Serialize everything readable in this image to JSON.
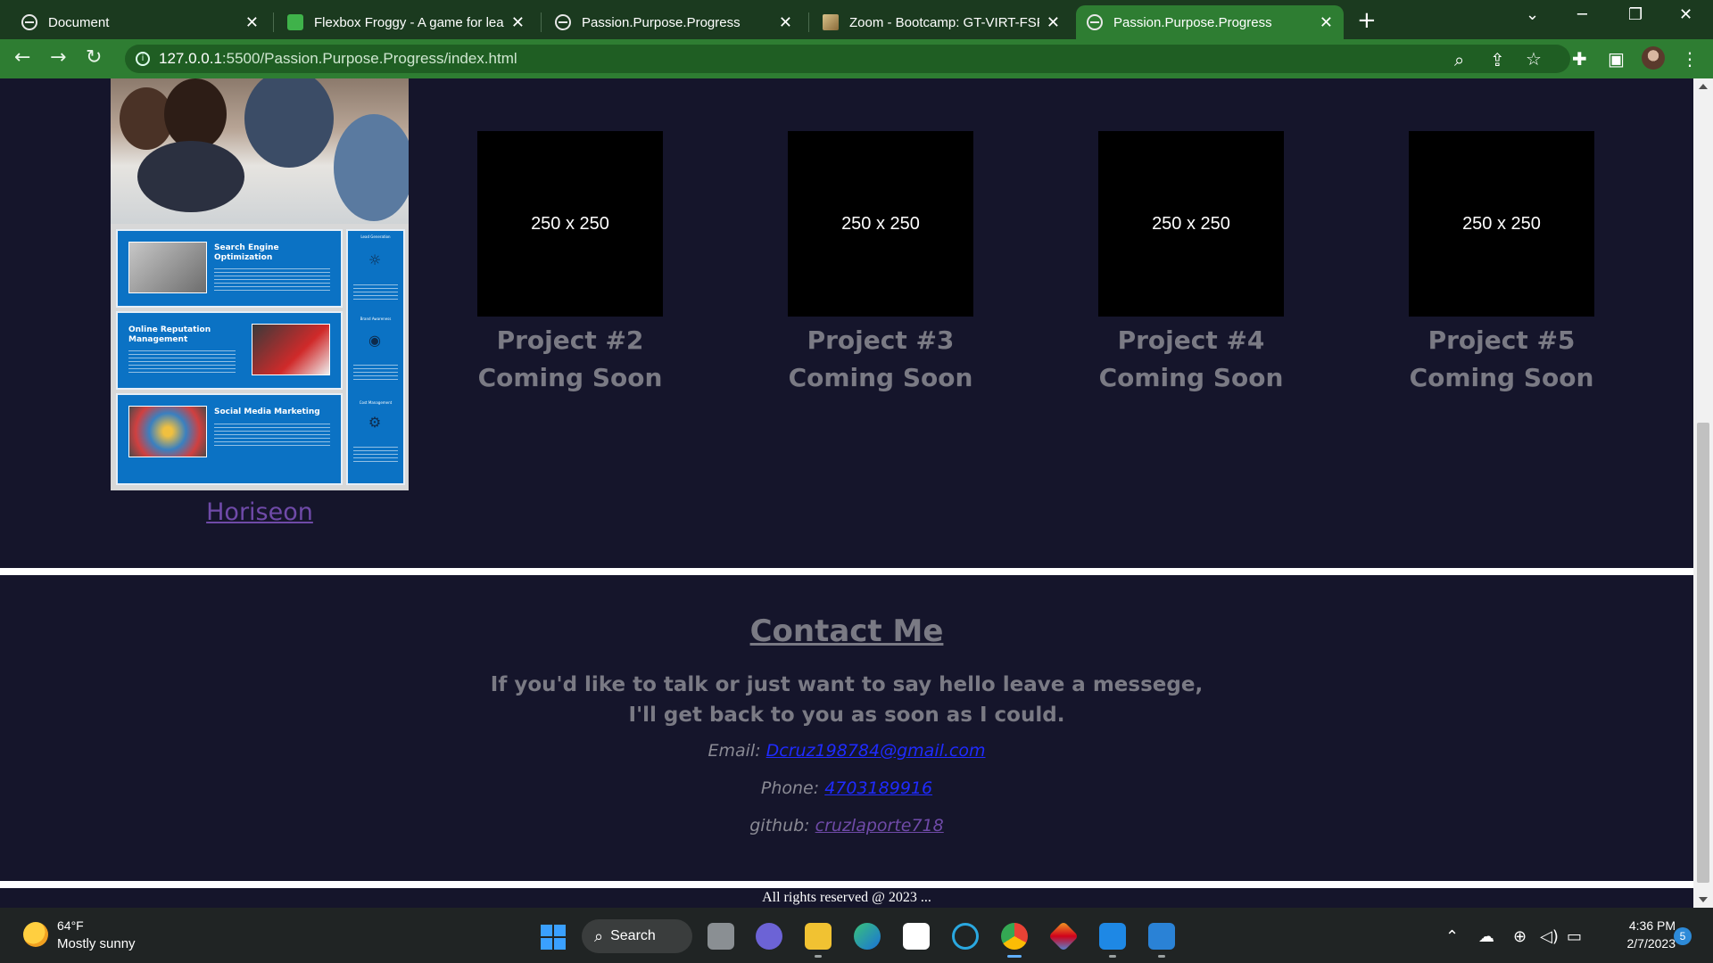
{
  "browser": {
    "tabs": [
      {
        "title": "Document",
        "close": "✕"
      },
      {
        "title": "Flexbox Froggy - A game for learning CSS flexbox",
        "close": "✕"
      },
      {
        "title": "Passion.Purpose.Progress",
        "close": "✕"
      },
      {
        "title": "Zoom - Bootcamp: GT-VIRT-FSF-",
        "close": "✕"
      },
      {
        "title": "Passion.Purpose.Progress",
        "close": "✕",
        "active": true
      }
    ],
    "new_tab": "+",
    "url_host": "127.0.0.1",
    "url_rest": ":5500/Passion.Purpose.Progress/index.html",
    "accent": "#2e7d32"
  },
  "portfolio": {
    "featured": {
      "title": "Horiseon"
    },
    "panel": {
      "sections": [
        {
          "heading": "Search Engine Optimization"
        },
        {
          "heading": "Online Reputation Management"
        },
        {
          "heading": "Social Media Marketing"
        }
      ],
      "side": [
        "Lead Generation",
        "Brand Awareness",
        "Cost Management"
      ]
    },
    "placeholders": [
      {
        "size": "250 x 250",
        "title": "Project #2",
        "status": "Coming Soon"
      },
      {
        "size": "250 x 250",
        "title": "Project #3",
        "status": "Coming Soon"
      },
      {
        "size": "250 x 250",
        "title": "Project #4",
        "status": "Coming Soon"
      },
      {
        "size": "250 x 250",
        "title": "Project #5",
        "status": "Coming Soon"
      }
    ]
  },
  "contact": {
    "heading": "Contact Me",
    "message_line1": "If you'd like to talk or just want to say hello leave a messege,",
    "message_line2": "I'll get back to you as soon as I could.",
    "email_label": "Email:",
    "email": "Dcruz198784@gmail.com",
    "phone_label": "Phone:",
    "phone": "4703189916",
    "github_label": "github:",
    "github": "cruzlaporte718"
  },
  "footer": {
    "text": "All rights reserved @ 2023 ..."
  },
  "taskbar": {
    "weather_temp": "64°F",
    "weather_desc": "Mostly sunny",
    "search_label": "Search",
    "time": "4:36 PM",
    "date": "2/7/2023",
    "notifications": "5"
  }
}
